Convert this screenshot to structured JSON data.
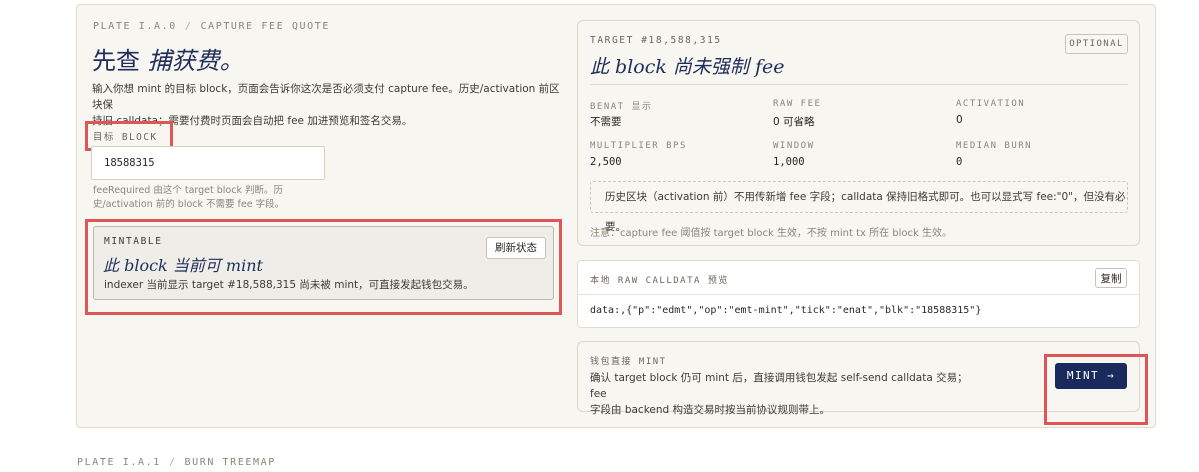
{
  "breadcrumb": {
    "plate": "PLATE I.A.0",
    "sep": "/",
    "section": "CAPTURE FEE QUOTE"
  },
  "headline": {
    "plain": "先查 ",
    "italic": "捕获费。"
  },
  "intro": {
    "line1": "输入你想 mint 的目标 block，页面会告诉你这次是否必须支付 capture fee。历史/activation 前区块保",
    "line2": "持旧 calldata；需要付费时页面会自动把 fee 加进预览和签名交易。"
  },
  "target_field": {
    "label": "目标 BLOCK",
    "value": "18588315",
    "help_line1": "feeRequired 由这个 target block 判断。历",
    "help_line2": "史/activation 前的 block 不需要 fee 字段。"
  },
  "status": {
    "tag": "MINTABLE",
    "title": "此 block 当前可 mint",
    "text": "indexer 当前显示 target #18,588,315 尚未被 mint，可直接发起钱包交易。",
    "refresh_label": "刷新状态"
  },
  "target_card": {
    "tag": "TARGET #18,588,315",
    "title": "此 block 尚未强制 fee",
    "optional_label": "OPTIONAL",
    "stats": [
      {
        "key": "BENAT 显示",
        "value": "不需要"
      },
      {
        "key": "RAW FEE",
        "value": "0 可省略"
      },
      {
        "key": "ACTIVATION",
        "value": "0"
      },
      {
        "key": "MULTIPLIER BPS",
        "value": "2,500"
      },
      {
        "key": "WINDOW",
        "value": "1,000"
      },
      {
        "key": "MEDIAN BURN",
        "value": "0"
      }
    ],
    "note": "历史区块（activation 前）不用传新增 fee 字段；calldata 保持旧格式即可。也可以显式写 fee:\"0\"，但没有必要。",
    "footnote": "注意：capture fee 阈值按 target block 生效，不按 mint tx 所在 block 生效。"
  },
  "calldata": {
    "label": "本地 RAW CALLDATA 预览",
    "copy_label": "复制",
    "code": "data:,{\"p\":\"edmt\",\"op\":\"emt-mint\",\"tick\":\"enat\",\"blk\":\"18588315\"}"
  },
  "wallet": {
    "label": "钱包直接 MINT",
    "line1": "确认 target block 仍可 mint 后，直接调用钱包发起 self-send calldata 交易；fee",
    "line2": "字段由 backend 构造交易时按当前协议规则带上。",
    "mint_label": "MINT →"
  },
  "next_section": {
    "plate": "PLATE I.A.1",
    "sep": "/",
    "section": "BURN TREEMAP"
  }
}
